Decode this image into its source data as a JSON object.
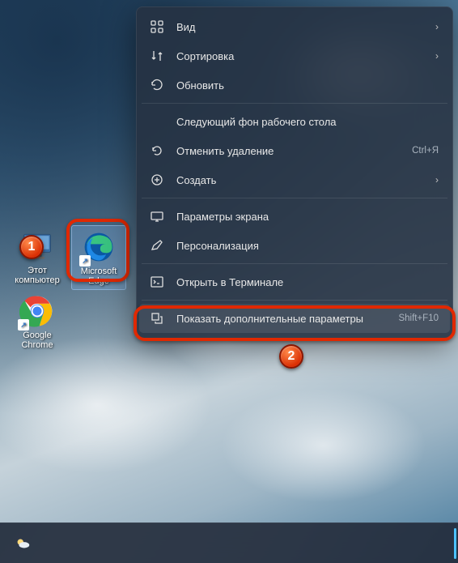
{
  "desktop": {
    "icons": [
      {
        "name": "this-pc",
        "label": "Этот компьютер"
      },
      {
        "name": "edge",
        "label": "Microsoft Edge"
      },
      {
        "name": "chrome",
        "label": "Google Chrome"
      }
    ]
  },
  "context_menu": {
    "items": [
      {
        "id": "view",
        "label": "Вид",
        "has_submenu": true
      },
      {
        "id": "sort",
        "label": "Сортировка",
        "has_submenu": true
      },
      {
        "id": "refresh",
        "label": "Обновить"
      },
      {
        "sep": true
      },
      {
        "id": "next-bg",
        "label": "Следующий фон рабочего стола"
      },
      {
        "id": "undo-delete",
        "label": "Отменить удаление",
        "shortcut": "Ctrl+Я"
      },
      {
        "id": "new",
        "label": "Создать",
        "has_submenu": true
      },
      {
        "sep": true
      },
      {
        "id": "display-settings",
        "label": "Параметры экрана"
      },
      {
        "id": "personalize",
        "label": "Персонализация"
      },
      {
        "sep": true
      },
      {
        "id": "open-terminal",
        "label": "Открыть в Терминале"
      },
      {
        "sep": true
      },
      {
        "id": "more-options",
        "label": "Показать дополнительные параметры",
        "shortcut": "Shift+F10"
      }
    ]
  },
  "callouts": {
    "badge1": "1",
    "badge2": "2"
  }
}
